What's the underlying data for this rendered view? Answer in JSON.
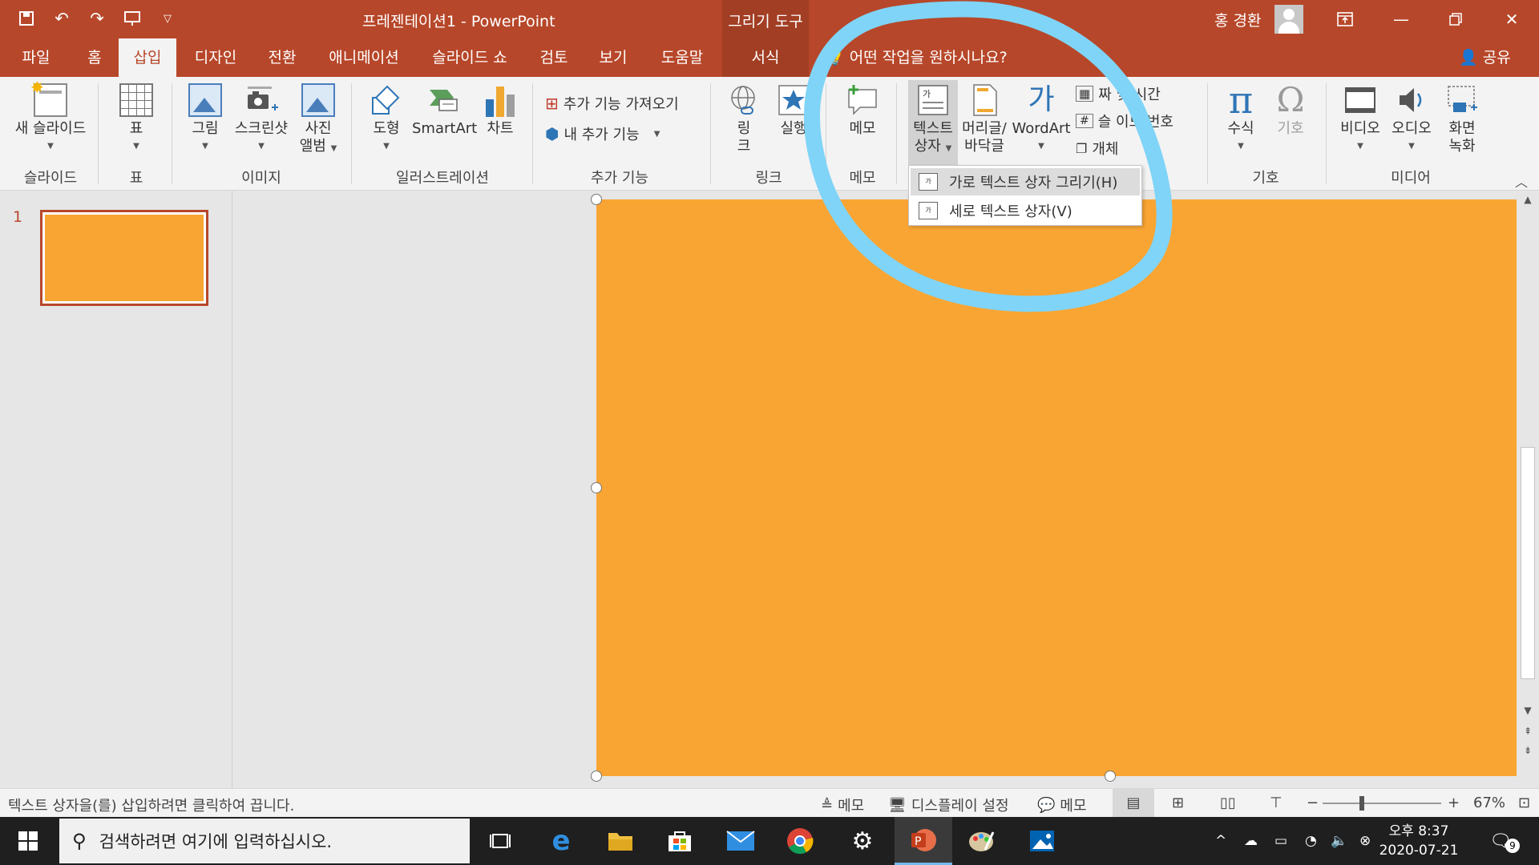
{
  "titlebar": {
    "doc_title": "프레젠테이션1  -  PowerPoint",
    "context_tool": "그리기 도구",
    "user_name": "홍 경환"
  },
  "tabs": [
    {
      "label": "파일",
      "active": false
    },
    {
      "label": "홈",
      "active": false
    },
    {
      "label": "삽입",
      "active": true
    },
    {
      "label": "디자인",
      "active": false
    },
    {
      "label": "전환",
      "active": false
    },
    {
      "label": "애니메이션",
      "active": false
    },
    {
      "label": "슬라이드 쇼",
      "active": false
    },
    {
      "label": "검토",
      "active": false
    },
    {
      "label": "보기",
      "active": false
    },
    {
      "label": "도움말",
      "active": false
    },
    {
      "label": "서식",
      "active": false
    }
  ],
  "tell_me": "어떤 작업을 원하시나요?",
  "share": "공유",
  "ribbon": {
    "new_slide": "새 슬라이드",
    "table": "표",
    "picture": "그림",
    "screenshot": "스크린샷",
    "photo_album_1": "사진",
    "photo_album_2": "앨범",
    "shapes": "도형",
    "smartart": "SmartArt",
    "chart": "차트",
    "get_addins": "추가 기능 가져오기",
    "my_addins": "내 추가 기능",
    "link_1": "링",
    "link_2": "크",
    "action": "실행",
    "comment": "메모",
    "textbox_1": "텍스트",
    "textbox_2": "상자",
    "header_footer_1": "머리글/",
    "header_footer_2": "바닥글",
    "wordart": "WordArt",
    "date_time": "짜 및 시간",
    "slide_number": "슬   이드 번호",
    "object": "개체",
    "equation": "수식",
    "symbol": "기호",
    "video": "비디오",
    "audio": "오디오",
    "screen_rec_1": "화면",
    "screen_rec_2": "녹화",
    "groups": {
      "slides": "슬라이드",
      "tables": "표",
      "images": "이미지",
      "illustrations": "일러스트레이션",
      "addins": "추가 기능",
      "links": "링크",
      "comments": "메모",
      "symbols": "기호",
      "media": "미디어"
    }
  },
  "textbox_menu": {
    "horizontal": "가로 텍스트 상자 그리기(H)",
    "vertical": "세로 텍스트 상자(V)",
    "h_icon_text": "가",
    "v_icon_text": "가"
  },
  "slides_pane": {
    "slide_number": "1"
  },
  "slide": {
    "fill_color": "#f9a533"
  },
  "annotation_color": "#7fd4f7",
  "statusbar": {
    "hint": "텍스트 상자을(를) 삽입하려면 클릭하여 끕니다.",
    "notes": "메모",
    "display": "디스플레이 설정",
    "comments": "메모",
    "zoom": "67%"
  },
  "taskbar": {
    "search_placeholder": "검색하려면 여기에 입력하십시오.",
    "time": "오후 8:37",
    "date": "2020-07-21",
    "notification_count": "9"
  },
  "accent": "#b7472a"
}
